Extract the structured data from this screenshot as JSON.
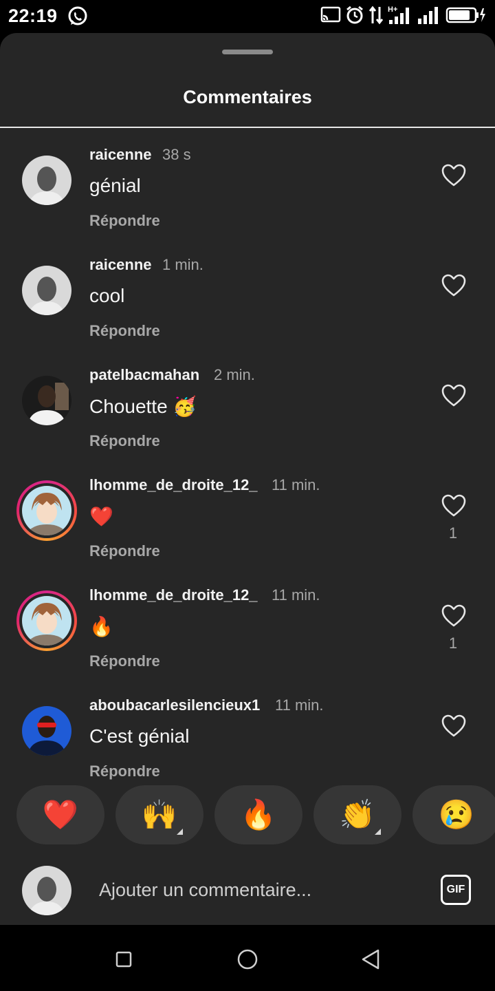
{
  "status_bar": {
    "time": "22:19",
    "icons": [
      "whatsapp-icon",
      "cast-icon",
      "alarm-icon",
      "data-transfer-icon",
      "signal-h-plus-icon",
      "signal-icon",
      "battery-charging-icon"
    ]
  },
  "sheet": {
    "title": "Commentaires"
  },
  "comments": [
    {
      "username": "raicenne",
      "time": "38 s",
      "text": "génial",
      "reply": "Répondre",
      "likes": ""
    },
    {
      "username": "raicenne",
      "time": "1 min.",
      "text": "cool",
      "reply": "Répondre",
      "likes": ""
    },
    {
      "username": "patelbacmahan",
      "time": "2 min.",
      "text": "Chouette 🥳",
      "reply": "Répondre",
      "likes": ""
    },
    {
      "username": "lhomme_de_droite_12_",
      "time": "11 min.",
      "text": "❤️",
      "reply": "Répondre",
      "likes": "1"
    },
    {
      "username": "lhomme_de_droite_12_",
      "time": "11 min.",
      "text": "🔥",
      "reply": "Répondre",
      "likes": "1"
    },
    {
      "username": "aboubacarlesilencieux1",
      "time": "11 min.",
      "text": "C'est génial",
      "reply": "Répondre",
      "likes": ""
    }
  ],
  "reactions": [
    "❤️",
    "🙌",
    "🔥",
    "👏",
    "😢"
  ],
  "composer": {
    "placeholder": "Ajouter un commentaire...",
    "gif_label": "GIF"
  },
  "colors": {
    "sheet_background": "#262626",
    "muted_text": "#a8a8a8",
    "story_ring": "#d7258b"
  }
}
